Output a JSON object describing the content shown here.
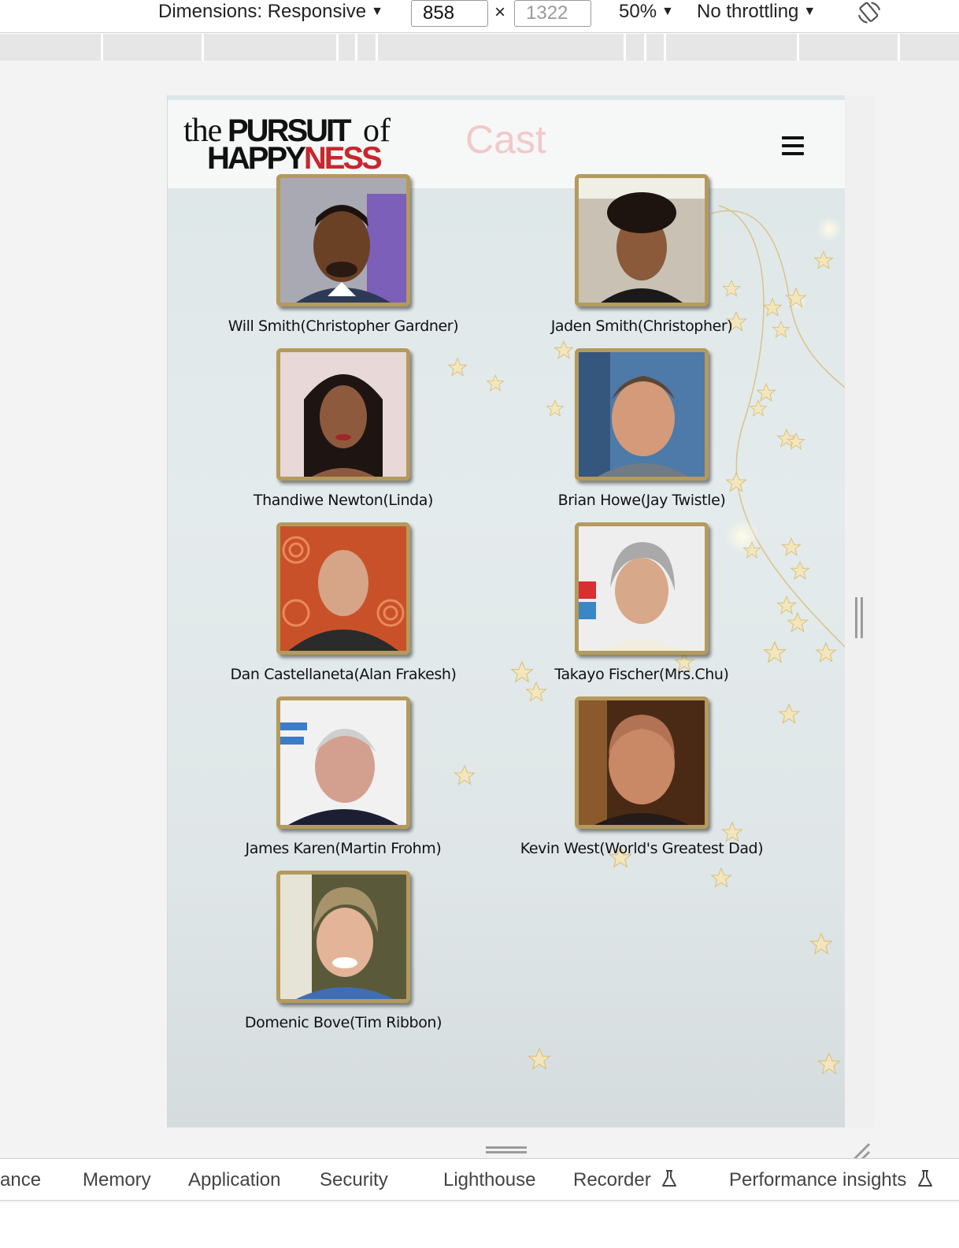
{
  "toolbar": {
    "dimensions_label": "Dimensions: Responsive",
    "width_value": "858",
    "times": "×",
    "height_placeholder": "1322",
    "zoom": "50%",
    "throttling": "No throttling",
    "rotate_icon": "rotate-icon"
  },
  "page": {
    "logo": {
      "the": "the",
      "pursuit": "PURSUIT",
      "of": "of",
      "happy": "HAPPY",
      "ness": "NESS"
    },
    "title": "Cast",
    "menu_icon": "hamburger-menu-icon",
    "cast": [
      {
        "name": "Will Smith(Christopher Gardner)"
      },
      {
        "name": "Jaden Smith(Christopher)"
      },
      {
        "name": "Thandiwe Newton(Linda)"
      },
      {
        "name": "Brian Howe(Jay Twistle)"
      },
      {
        "name": "Dan Castellaneta(Alan Frakesh)"
      },
      {
        "name": "Takayo Fischer(Mrs.Chu)"
      },
      {
        "name": "James Karen(Martin Frohm)"
      },
      {
        "name": "Kevin West(World's Greatest Dad)"
      },
      {
        "name": "Domenic Bove(Tim Ribbon)"
      }
    ]
  },
  "devtools_tabs": {
    "performance": "ance",
    "memory": "Memory",
    "application": "Application",
    "security": "Security",
    "lighthouse": "Lighthouse",
    "recorder": "Recorder",
    "performance_insights": "Performance insights"
  },
  "colors": {
    "logo_red": "#c8272d",
    "title_pink": "#f2c8cb",
    "frame_gold": "#b49a5d"
  }
}
